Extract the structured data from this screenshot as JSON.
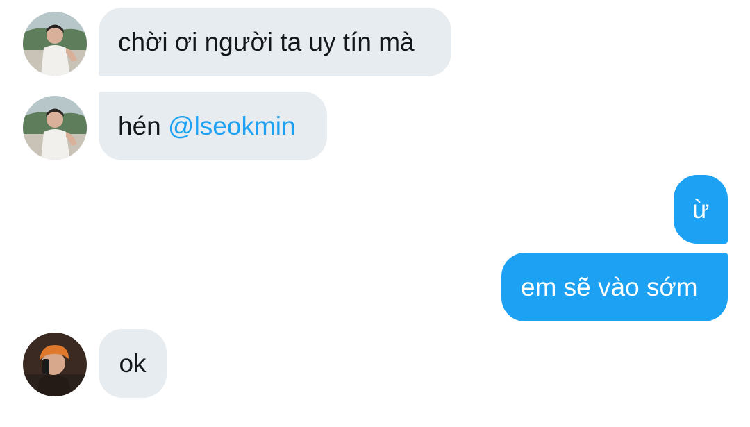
{
  "messages": [
    {
      "sender": "other-user",
      "text": "chời ơi người ta uy tín mà"
    },
    {
      "sender": "other-user",
      "text": "hén ",
      "mention": "@lseokmin"
    },
    {
      "sender": "me",
      "text": "ừ"
    },
    {
      "sender": "me",
      "text": "em sẽ vào sớm"
    },
    {
      "sender": "third-user",
      "text": "ok"
    }
  ],
  "colors": {
    "incoming_bubble": "#e6ecf0",
    "outgoing_bubble": "#1da1f2",
    "mention": "#1da1f2",
    "text": "#14171a"
  }
}
